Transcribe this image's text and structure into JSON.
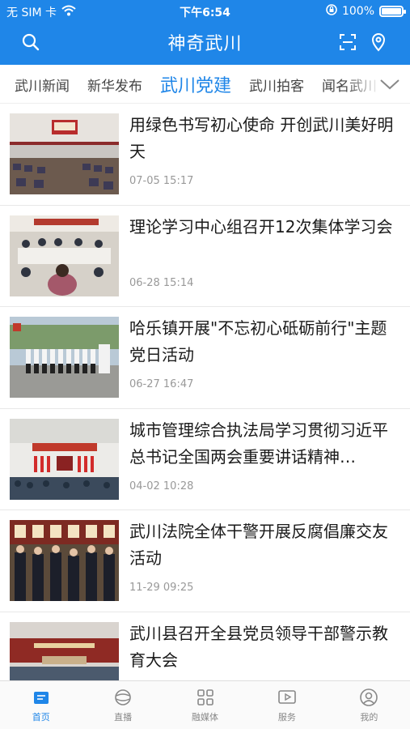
{
  "status_bar": {
    "carrier": "无 SIM 卡",
    "time": "下午6:54",
    "battery": "100%",
    "battery_level": 1.0
  },
  "header": {
    "title": "神奇武川",
    "icons": [
      "search-icon",
      "scan-icon",
      "location-icon"
    ]
  },
  "tabs": {
    "items": [
      "武川新闻",
      "新华发布",
      "武川党建",
      "武川拍客",
      "闻名武川"
    ],
    "active": "武川党建"
  },
  "news": [
    {
      "title": "用绿色书写初心使命 开创武川美好明天",
      "time": "07-05 15:17"
    },
    {
      "title": "理论学习中心组召开12次集体学习会",
      "time": "06-28 15:14"
    },
    {
      "title": "哈乐镇开展\"不忘初心砥砺前行\"主题党日活动",
      "time": "06-27 16:47"
    },
    {
      "title": "城市管理综合执法局学习贯彻习近平总书记全国两会重要讲话精神…",
      "time": "04-02 10:28"
    },
    {
      "title": "武川法院全体干警开展反腐倡廉交友活动",
      "time": "11-29 09:25"
    },
    {
      "title": "武川县召开全县党员领导干部警示教育大会",
      "time": ""
    }
  ],
  "bottom_nav": {
    "items": [
      {
        "label": "首页",
        "icon": "home-icon"
      },
      {
        "label": "直播",
        "icon": "live-icon"
      },
      {
        "label": "融媒体",
        "icon": "grid-icon"
      },
      {
        "label": "服务",
        "icon": "play-icon"
      },
      {
        "label": "我的",
        "icon": "user-icon"
      }
    ],
    "active": "首页"
  },
  "colors": {
    "brand": "#1f86e8",
    "text": "#1a1a1a",
    "muted": "#999999"
  }
}
